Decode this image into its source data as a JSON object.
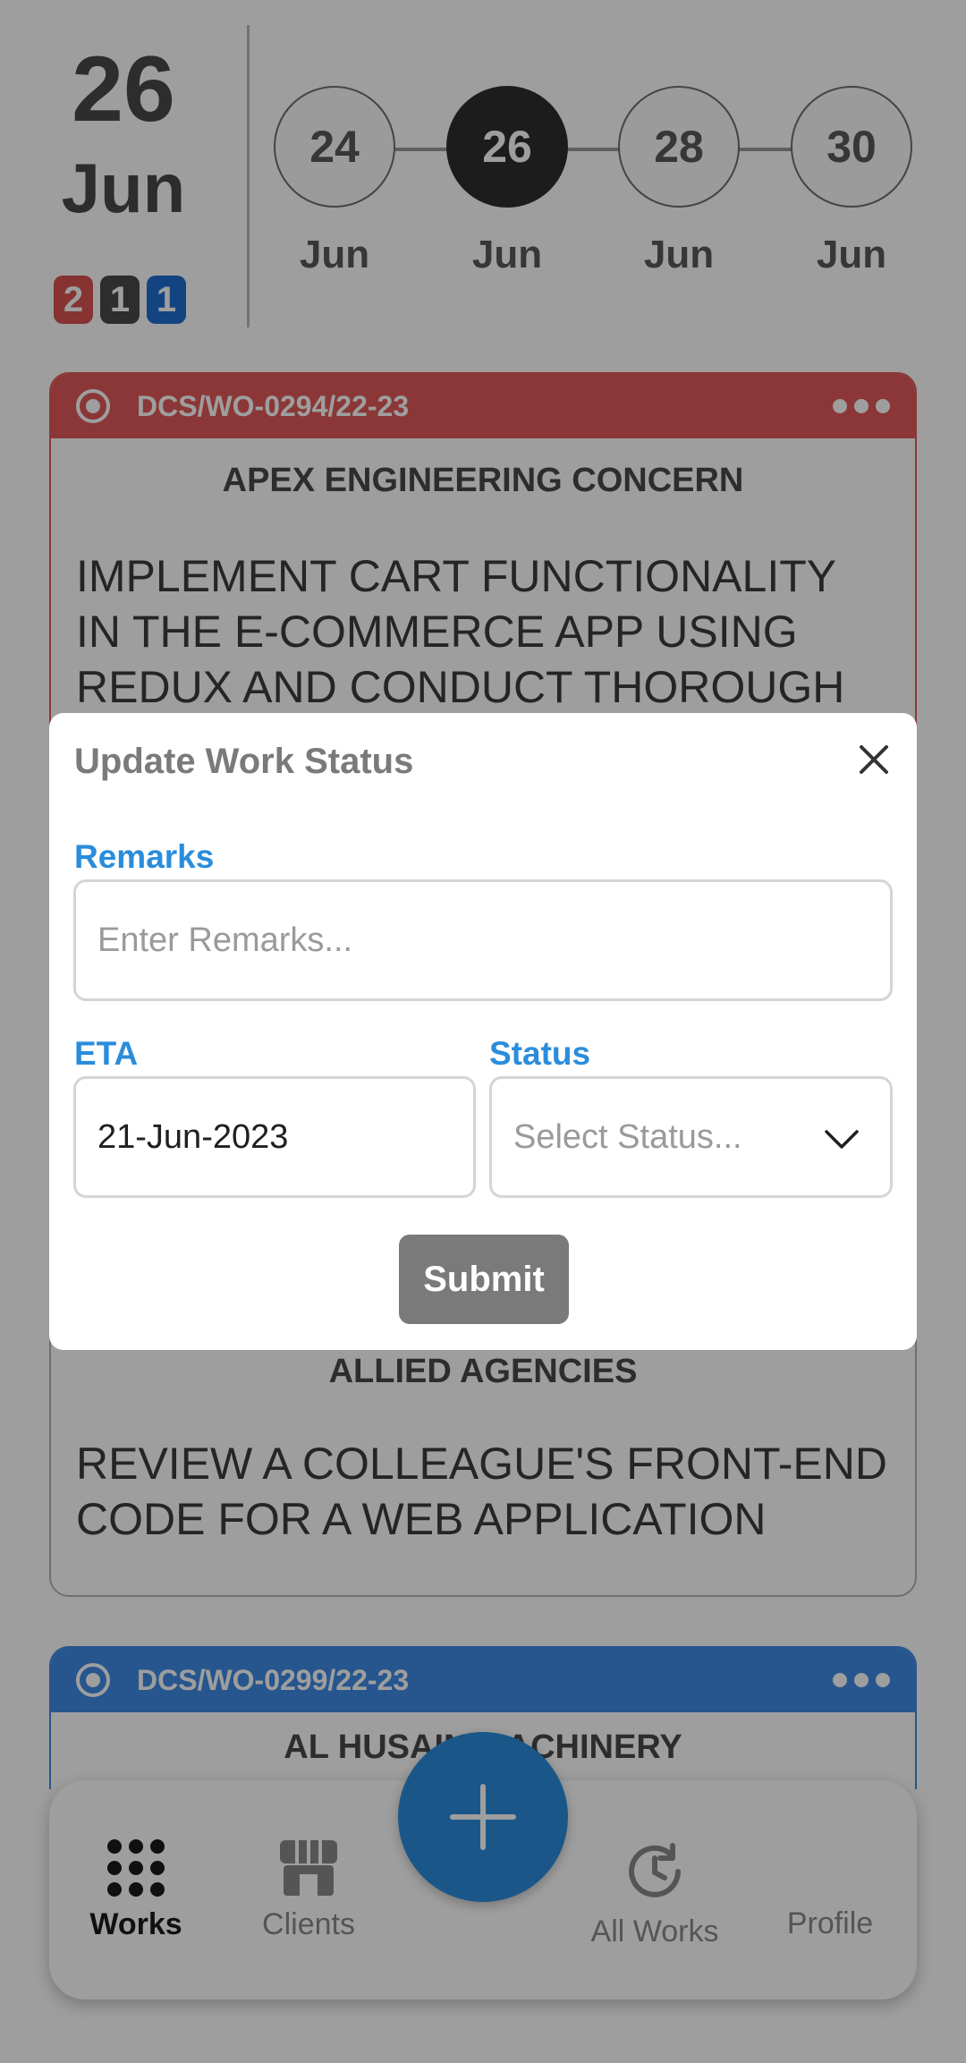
{
  "header": {
    "day": "26",
    "month": "Jun",
    "badges": [
      {
        "count": "2",
        "color": "#d9534f"
      },
      {
        "count": "1",
        "color": "#4a4a4a"
      },
      {
        "count": "1",
        "color": "#1e6fd1"
      }
    ],
    "dates": [
      {
        "day": "24",
        "month": "Jun",
        "selected": false
      },
      {
        "day": "26",
        "month": "Jun",
        "selected": true
      },
      {
        "day": "28",
        "month": "Jun",
        "selected": false
      },
      {
        "day": "30",
        "month": "Jun",
        "selected": false
      }
    ]
  },
  "cards": [
    {
      "code": "DCS/WO-0294/22-23",
      "header_color": "#e05a5a",
      "client": "APEX ENGINEERING CONCERN",
      "task": "IMPLEMENT CART FUNCTIONALITY IN THE E-COMMERCE APP USING REDUX AND CONDUCT THOROUGH"
    },
    {
      "client": "ALLIED AGENCIES",
      "task": "REVIEW A COLLEAGUE'S FRONT-END CODE FOR A WEB APPLICATION"
    },
    {
      "code": "DCS/WO-0299/22-23",
      "header_color": "#3f8be6",
      "client": "AL HUSAIN MACHINERY"
    }
  ],
  "modal": {
    "title": "Update Work Status",
    "remarks_label": "Remarks",
    "remarks_placeholder": "Enter Remarks...",
    "eta_label": "ETA",
    "eta_value": "21-Jun-2023",
    "status_label": "Status",
    "status_placeholder": "Select Status...",
    "submit_label": "Submit"
  },
  "nav": {
    "items": [
      {
        "label": "Works",
        "icon": "grid-dots-icon",
        "active": true
      },
      {
        "label": "Clients",
        "icon": "storefront-icon",
        "active": false
      },
      {
        "label": "All Works",
        "icon": "history-clock-icon",
        "active": false
      },
      {
        "label": "Profile",
        "icon": "profile-icon",
        "active": false
      }
    ],
    "fab_icon": "plus-icon"
  },
  "colors": {
    "accent": "#2a8ddc",
    "overlay": "rgba(0,0,0,0.38)"
  }
}
